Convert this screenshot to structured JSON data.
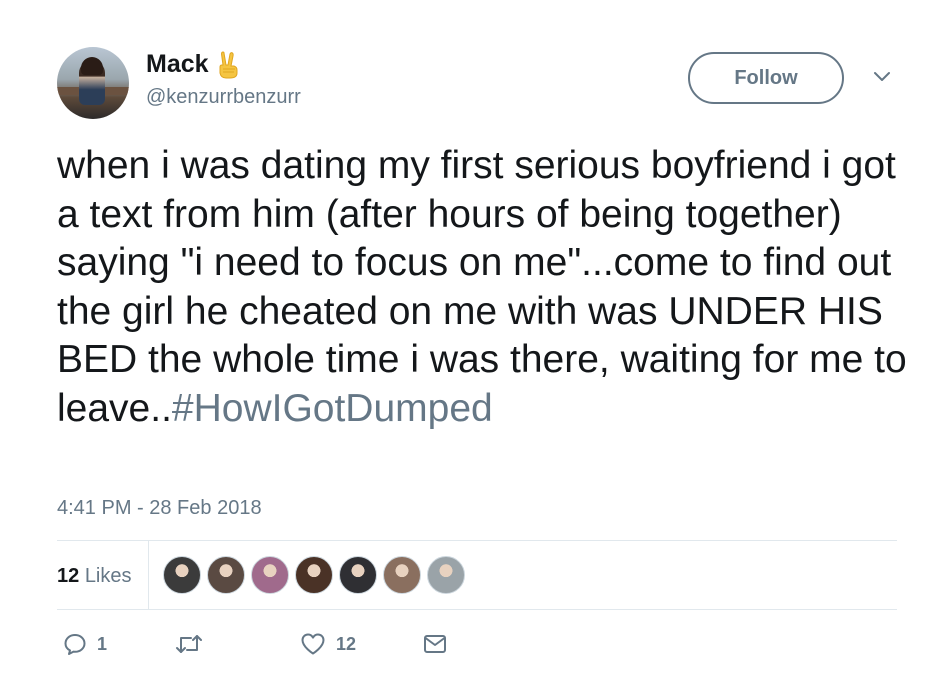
{
  "user": {
    "display_name": "Mack",
    "name_emoji": "✌",
    "handle": "@kenzurrbenzurr"
  },
  "follow_label": "Follow",
  "tweet": {
    "text": "when i was dating my first serious boyfriend i got a text from him (after hours of being together) saying \"i need to focus on me\"...come to find out the girl he cheated on me with was UNDER HIS BED the whole time i was there, waiting for me to leave..",
    "hashtag": "#HowIGotDumped"
  },
  "timestamp": "4:41 PM - 28 Feb 2018",
  "stats": {
    "likes_count": "12",
    "likes_label": "Likes"
  },
  "likers": [
    {
      "name": "liker-1",
      "color": "#3b3b3b"
    },
    {
      "name": "liker-2",
      "color": "#5a4a42"
    },
    {
      "name": "liker-3",
      "color": "#a06a8c"
    },
    {
      "name": "liker-4",
      "color": "#4a3226"
    },
    {
      "name": "liker-5",
      "color": "#2f2f33"
    },
    {
      "name": "liker-6",
      "color": "#8a6f5f"
    },
    {
      "name": "liker-7",
      "color": "#9aa3a8"
    }
  ],
  "actions": {
    "reply_count": "1",
    "retweet_count": "",
    "like_count": "12"
  },
  "colors": {
    "secondary": "#657786",
    "primary_text": "#14171a",
    "divider": "#e1e8ed",
    "emoji": "#f5c542"
  }
}
